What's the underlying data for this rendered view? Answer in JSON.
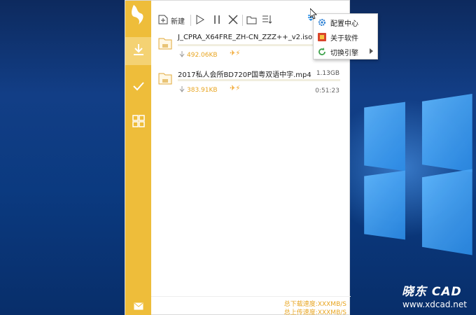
{
  "toolbar": {
    "new_label": "新建"
  },
  "downloads": [
    {
      "name": "J_CPRA_X64FRE_ZH-CN_ZZZ++_v2.iso",
      "size": "",
      "speed": "492.06KB",
      "eta": "",
      "progress": 0.0
    },
    {
      "name": "2017私人会所BD720P国粤双语中字.mp4",
      "size": "1.13GB",
      "speed": "383.91KB",
      "eta": "0:51:23",
      "progress": 0.0
    }
  ],
  "menu": {
    "items": [
      {
        "label": "配置中心",
        "icon": "gear-icon"
      },
      {
        "label": "关于软件",
        "icon": "info-box-icon"
      },
      {
        "label": "切换引擎",
        "icon": "refresh-icon"
      }
    ]
  },
  "status": {
    "download_speed": "总下载速度:XXXMB/S",
    "upload_speed": "总上传速度:XXXMB/S"
  },
  "watermark": {
    "logo": "晓东 CAD",
    "url": "www.xdcad.net"
  },
  "colors": {
    "accent": "#eebd3a",
    "accent_light": "#f4d273",
    "speed_text": "#e8a520"
  }
}
